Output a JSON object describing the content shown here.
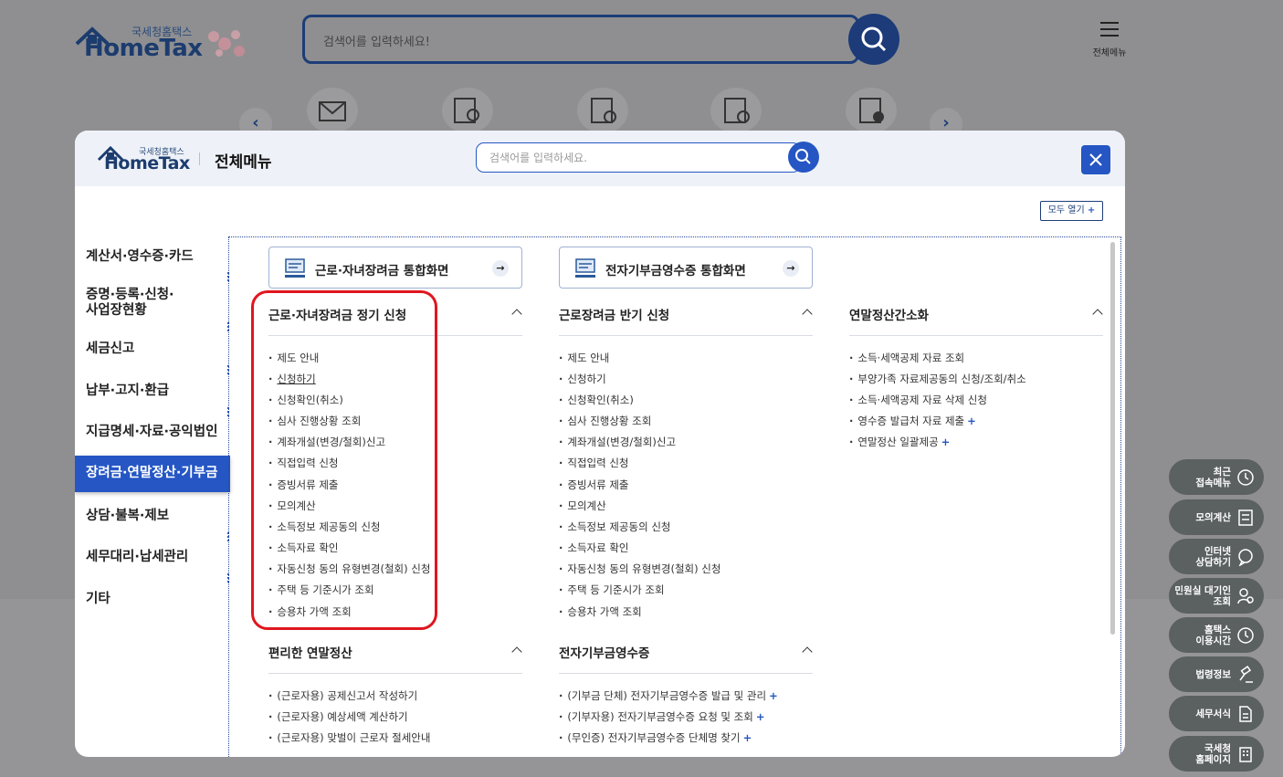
{
  "background": {
    "logo_small": "국세청홈택스",
    "logo_big": "HomeTax",
    "search_placeholder": "검색어를 입력하세요!",
    "menu_label": "전체메뉴",
    "prev_arrow": "‹",
    "next_arrow": "›"
  },
  "modal": {
    "logo_small": "국세청홈택스",
    "logo_big": "HomeTax",
    "title": "전체메뉴",
    "search_placeholder": "검색어를 입력하세요.",
    "open_all_label": "모두 열기",
    "open_all_plus": "+"
  },
  "sidebar": {
    "items": [
      {
        "label": "계산서·영수증·카드"
      },
      {
        "label": "증명·등록·신청·\n사업장현황"
      },
      {
        "label": "세금신고"
      },
      {
        "label": "납부·고지·환급"
      },
      {
        "label": "지급명세·자료·공익법인"
      },
      {
        "label": "장려금·연말정산·기부금",
        "active": true
      },
      {
        "label": "상담·불복·제보"
      },
      {
        "label": "세무대리·납세관리"
      },
      {
        "label": "기타"
      }
    ]
  },
  "portals": [
    {
      "label": "근로·자녀장려금 통합화면",
      "arrow": "→"
    },
    {
      "label": "전자기부금영수증 통합화면",
      "arrow": "→"
    }
  ],
  "sections": [
    {
      "title": "근로·자녀장려금 정기 신청",
      "items": [
        "제도 안내",
        "신청하기",
        "신청확인(취소)",
        "심사 진행상황 조회",
        "계좌개설(변경/철회)신고",
        "직접입력 신청",
        "증빙서류 제출",
        "모의계산",
        "소득정보 제공동의 신청",
        "소득자료 확인",
        "자동신청 동의 유형변경(철회) 신청",
        "주택 등 기준시가 조회",
        "승용차 가액 조회"
      ]
    },
    {
      "title": "근로장려금 반기 신청",
      "items": [
        "제도 안내",
        "신청하기",
        "신청확인(취소)",
        "심사 진행상황 조회",
        "계좌개설(변경/철회)신고",
        "직접입력 신청",
        "증빙서류 제출",
        "모의계산",
        "소득정보 제공동의 신청",
        "소득자료 확인",
        "자동신청 동의 유형변경(철회) 신청",
        "주택 등 기준시가 조회",
        "승용차 가액 조회"
      ]
    },
    {
      "title": "연말정산간소화",
      "items": [
        "소득·세액공제 자료 조회",
        "부양가족 자료제공동의 신청/조회/취소",
        "소득·세액공제 자료 삭제 신청",
        "영수증 발급처 자료 제출",
        "연말정산 일괄제공"
      ]
    },
    {
      "title": "편리한 연말정산",
      "items": [
        "(근로자용) 공제신고서 작성하기",
        "(근로자용) 예상세액 계산하기",
        "(근로자용) 맞벌이 근로자 절세안내"
      ]
    },
    {
      "title": "전자기부금영수증",
      "items": [
        "(기부금 단체) 전자기부금영수증 발급 및 관리",
        "(기부자용) 전자기부금영수증 요청 및 조회",
        "(무인증) 전자기부금영수증 단체명 찾기"
      ]
    }
  ],
  "plus_sign": "+",
  "fabs": [
    {
      "label": "최근\n접속메뉴",
      "icon": "clock-icon"
    },
    {
      "label": "모의계산",
      "icon": "calculator-icon"
    },
    {
      "label": "인터넷\n상담하기",
      "icon": "chat-icon"
    },
    {
      "label": "민원실 대기인\n조회",
      "icon": "person-search-icon"
    },
    {
      "label": "홈택스\n이용시간",
      "icon": "clock-icon"
    },
    {
      "label": "법령정보",
      "icon": "gavel-icon"
    },
    {
      "label": "세무서식",
      "icon": "document-icon"
    },
    {
      "label": "국세청\n홈페이지",
      "icon": "building-icon"
    }
  ],
  "colors": {
    "primary": "#2556c4",
    "navy": "#1d3d78",
    "highlight": "#e0161f",
    "overlay": "#8f8f91"
  }
}
